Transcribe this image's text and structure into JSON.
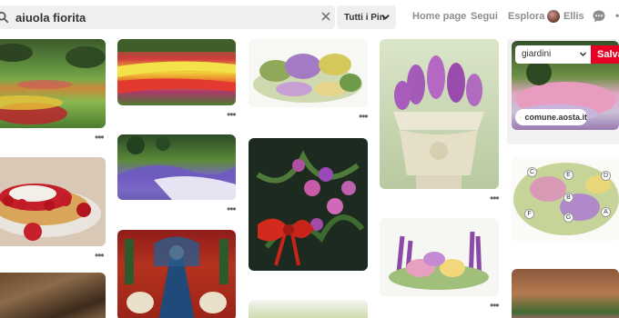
{
  "search": {
    "value": "aiuola fiorita",
    "filter_label": "Tutti i Pin"
  },
  "nav": {
    "home": "Home page",
    "following": "Segui",
    "explore": "Esplora",
    "user": "Ellis"
  },
  "pin_more_label": "•••",
  "feature": {
    "board": "giardini",
    "save": "Salva",
    "source": "comune.aosta.it"
  },
  "plan_labels": [
    "C",
    "E",
    "D",
    "B",
    "F",
    "G",
    "A"
  ],
  "colors": {
    "save_red": "#e60023",
    "search_bg": "#efefef",
    "nav_text": "#8e8e8e"
  }
}
